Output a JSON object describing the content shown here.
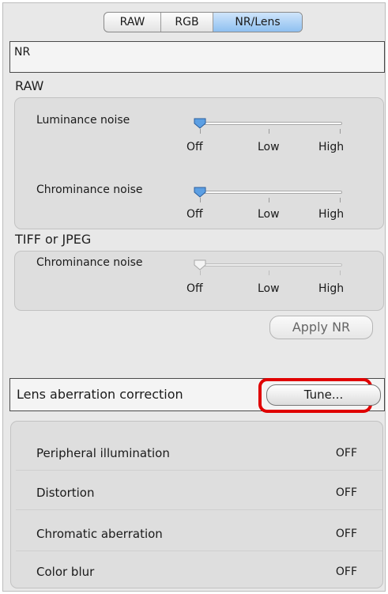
{
  "tabs": [
    {
      "label": "RAW",
      "active": false
    },
    {
      "label": "RGB",
      "active": false
    },
    {
      "label": "NR/Lens",
      "active": true
    }
  ],
  "nr_section": {
    "header": "NR",
    "raw": {
      "label": "RAW",
      "luminance": {
        "label": "Luminance noise",
        "value": "Off"
      },
      "chrominance": {
        "label": "Chrominance noise",
        "value": "Off"
      }
    },
    "tiff_jpeg": {
      "label": "TIFF or JPEG",
      "chrominance": {
        "label": "Chrominance noise",
        "value": "Off",
        "enabled": false
      }
    },
    "ticks": {
      "off": "Off",
      "low": "Low",
      "high": "High"
    },
    "apply_button": "Apply NR"
  },
  "lens_section": {
    "header": "Lens aberration correction",
    "tune_button": "Tune...",
    "rows": [
      {
        "label": "Peripheral illumination",
        "value": "OFF"
      },
      {
        "label": "Distortion",
        "value": "OFF"
      },
      {
        "label": "Chromatic aberration",
        "value": "OFF"
      },
      {
        "label": "Color blur",
        "value": "OFF"
      }
    ]
  },
  "colors": {
    "highlight": "#e00000",
    "active_tab": "#9cc8f2"
  }
}
